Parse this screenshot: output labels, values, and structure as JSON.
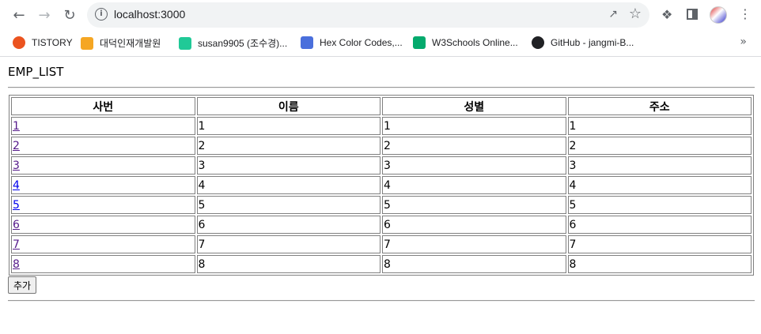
{
  "browser": {
    "url": "localhost:3000",
    "bookmarks": [
      {
        "label": "TISTORY",
        "icon": "tistory-icon",
        "color": "#eb531f"
      },
      {
        "label": "대덕인재개발원",
        "icon": "ddit-icon",
        "color": "#f5a623"
      },
      {
        "label": "susan9905 (조수경)...",
        "icon": "velog-icon",
        "color": "#20c997"
      },
      {
        "label": "Hex Color Codes,...",
        "icon": "book-icon",
        "color": "#4a6fdc"
      },
      {
        "label": "W3Schools Online...",
        "icon": "w3schools-icon",
        "color": "#04aa6d"
      },
      {
        "label": "GitHub - jangmi-B...",
        "icon": "github-icon",
        "color": "#202124"
      }
    ]
  },
  "page": {
    "title": "EMP_LIST",
    "headers": [
      "사번",
      "이름",
      "성별",
      "주소"
    ],
    "rows": [
      [
        "1",
        "1",
        "1",
        "1"
      ],
      [
        "2",
        "2",
        "2",
        "2"
      ],
      [
        "3",
        "3",
        "3",
        "3"
      ],
      [
        "4",
        "4",
        "4",
        "4"
      ],
      [
        "5",
        "5",
        "5",
        "5"
      ],
      [
        "6",
        "6",
        "6",
        "6"
      ],
      [
        "7",
        "7",
        "7",
        "7"
      ],
      [
        "8",
        "8",
        "8",
        "8"
      ]
    ],
    "add_label": "추가"
  }
}
